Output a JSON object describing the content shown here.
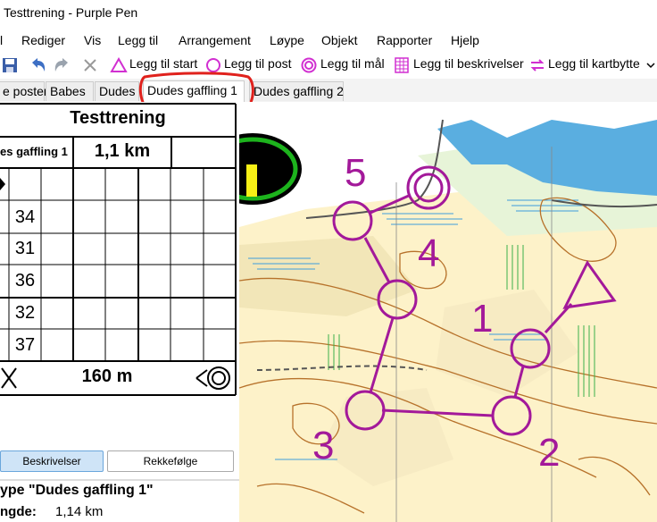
{
  "window": {
    "title": "Testtrening - Purple Pen"
  },
  "menu": [
    "l",
    "Rediger",
    "Vis",
    "Legg til",
    "Arrangement",
    "Løype",
    "Objekt",
    "Rapporter",
    "Hjelp"
  ],
  "toolbar": {
    "add_start": "Legg til start",
    "add_control": "Legg til post",
    "add_finish": "Legg til mål",
    "add_descriptions": "Legg til beskrivelser",
    "add_map_exchange": "Legg til kartbytte"
  },
  "tabs": [
    "e poster",
    "Babes",
    "Dudes",
    "Dudes gaffling 1",
    "Dudes gaffling 2"
  ],
  "description_sheet": {
    "title": "Testtrening",
    "course_name": "es gaffling 1",
    "length": "1,1 km",
    "controls": [
      "34",
      "31",
      "36",
      "32",
      "37"
    ],
    "finish_distance": "160 m"
  },
  "buttons": {
    "descriptions": "Beskrivelser",
    "order": "Rekkefølge"
  },
  "properties": {
    "type_line": "ype \"Dudes gaffling 1\"",
    "length_label": "ngde:",
    "length_value": "1,14 km"
  },
  "map": {
    "control_numbers": [
      "1",
      "2",
      "3",
      "4",
      "5"
    ],
    "accent_color": "#a3199a"
  }
}
